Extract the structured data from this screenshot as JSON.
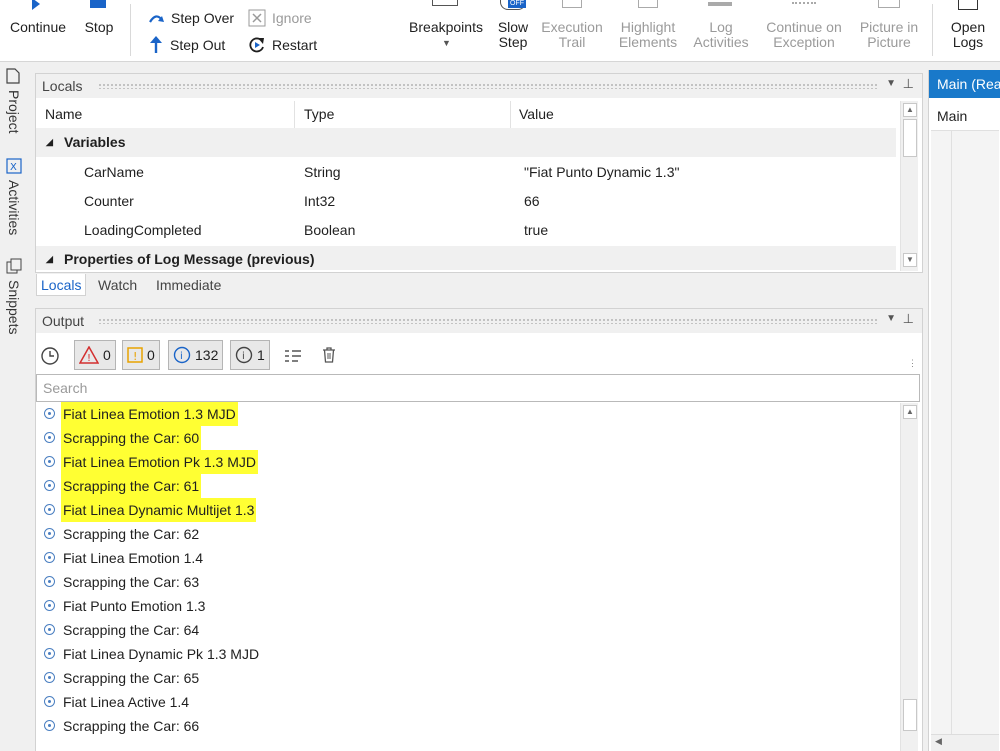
{
  "ribbon": {
    "continue": "Continue",
    "stop": "Stop",
    "step_over": "Step Over",
    "ignore": "Ignore",
    "step_out": "Step Out",
    "restart": "Restart",
    "breakpoints": "Breakpoints",
    "slow_step": [
      "Slow",
      "Step"
    ],
    "slow_badge": "OFF",
    "execution_trail": [
      "Execution",
      "Trail"
    ],
    "highlight_elements": [
      "Highlight",
      "Elements"
    ],
    "log_activities": [
      "Log",
      "Activities"
    ],
    "continue_on_exception": [
      "Continue on",
      "Exception"
    ],
    "picture_in_picture": [
      "Picture in",
      "Picture"
    ],
    "open_logs": [
      "Open",
      "Logs"
    ]
  },
  "sidebar": {
    "tabs": [
      "Project",
      "Activities",
      "Snippets"
    ]
  },
  "locals": {
    "title": "Locals",
    "columns": [
      "Name",
      "Type",
      "Value"
    ],
    "groups": [
      "Variables",
      "Properties of Log Message (previous)"
    ],
    "rows": [
      {
        "name": "CarName",
        "type": "String",
        "value": "\"Fiat Punto Dynamic 1.3\""
      },
      {
        "name": "Counter",
        "type": "Int32",
        "value": "66"
      },
      {
        "name": "LoadingCompleted",
        "type": "Boolean",
        "value": "true"
      }
    ],
    "tabs": [
      "Locals",
      "Watch",
      "Immediate"
    ]
  },
  "output": {
    "title": "Output",
    "filters": {
      "errors": "0",
      "warnings": "0",
      "info": "132",
      "trace": "1"
    },
    "search_placeholder": "Search",
    "lines": [
      "Fiat Linea Emotion 1.3 MJD",
      "Scrapping the Car: 60",
      "Fiat Linea Emotion Pk 1.3 MJD",
      "Scrapping the Car: 61",
      "Fiat Linea Dynamic Multijet 1.3",
      "Scrapping the Car: 62",
      "Fiat Linea Emotion 1.4",
      "Scrapping the Car: 63",
      "Fiat Punto Emotion 1.3",
      "Scrapping the Car: 64",
      "Fiat Linea Dynamic Pk 1.3 MJD",
      "Scrapping the Car: 65",
      "Fiat Linea Active 1.4",
      "Scrapping the Car: 66"
    ],
    "highlighted": [
      true,
      true,
      true,
      true,
      true,
      false,
      false,
      false,
      false,
      false,
      false,
      false,
      false,
      false
    ]
  },
  "rightpanel": {
    "tab": "Main (Rea",
    "label": "Main"
  },
  "colors": {
    "accent": "#1a64c8",
    "highlight": "#ffff33",
    "tab_blue": "#1979ca"
  }
}
